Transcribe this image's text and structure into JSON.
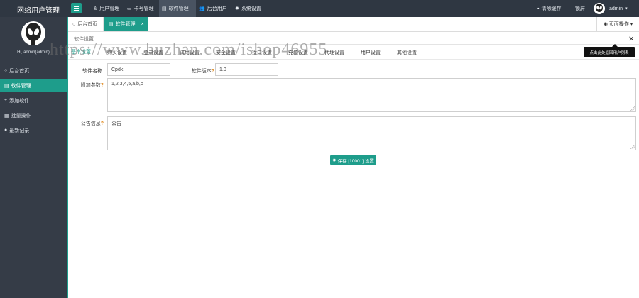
{
  "app": {
    "title": "网络用户管理"
  },
  "topnav": {
    "items": [
      {
        "label": "用户管理",
        "icon": "user-icon"
      },
      {
        "label": "卡号管理",
        "icon": "card-icon"
      },
      {
        "label": "软件管理",
        "icon": "software-icon",
        "active": true
      },
      {
        "label": "后台用户",
        "icon": "admin-users-icon"
      },
      {
        "label": "系统设置",
        "icon": "gear-icon"
      }
    ],
    "right": {
      "clear_cache": "清除缓存",
      "lock": "锁屏",
      "user": "admin"
    }
  },
  "sidebar": {
    "user_line": "Hi, admin(admin)",
    "items": [
      {
        "label": "后台首页",
        "icon": "circle-icon"
      },
      {
        "label": "软件管理",
        "icon": "software-icon",
        "active": true
      },
      {
        "label": "添加软件",
        "icon": "plus-icon"
      },
      {
        "label": "批量操作",
        "icon": "batch-icon"
      },
      {
        "label": "最新记录",
        "icon": "dot-icon"
      }
    ]
  },
  "tabs": {
    "home": "后台首页",
    "current": "软件管理",
    "page_ops": "页面操作"
  },
  "panel": {
    "title": "软件设置",
    "subtabs": [
      "基本设置",
      "购买设置",
      "登录设置",
      "试用设置",
      "安全设置",
      "接口设置",
      "充值设置",
      "代理设置",
      "用户设置",
      "其他设置"
    ]
  },
  "tooltip": {
    "text": "点击此处返回用户列表"
  },
  "form": {
    "software_name_label": "软件名称",
    "software_name": "Cpdk",
    "version_label": "软件版本",
    "version": "1.0",
    "extra_params_label": "附加参数",
    "extra_params": "1,2,3,4,5,a,b,c",
    "notice_label": "公告信息",
    "notice": "公告",
    "save_label": "保存 [10001] 设置"
  },
  "watermark": "https://www.huzhan.com/ishop46955",
  "colors": {
    "accent": "#1e9d8b",
    "topbar": "#2f3742",
    "sidebar": "#353c47"
  }
}
